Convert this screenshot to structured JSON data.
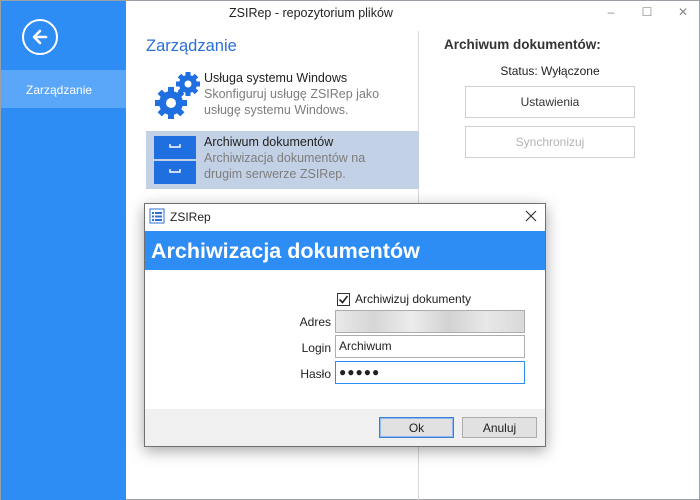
{
  "window": {
    "title": "ZSIRep - repozytorium plików",
    "minimize": "–",
    "maximize": "☐",
    "close": "✕"
  },
  "sidebar": {
    "back_icon": "arrow-left-circle-icon",
    "items": [
      {
        "label": "Zarządzanie"
      }
    ]
  },
  "main": {
    "section_title": "Zarządzanie",
    "items": [
      {
        "title": "Usługa systemu Windows",
        "description": "Skonfiguruj usługę ZSIRep jako usługę systemu Windows.",
        "icon": "gears-icon"
      },
      {
        "title": "Archiwum dokumentów",
        "description": "Archiwizacja dokumentów na drugim serwerze ZSIRep.",
        "icon": "archive-drawer-icon"
      }
    ]
  },
  "right_panel": {
    "title": "Archiwum dokumentów:",
    "status": "Status: Wyłączone",
    "settings_button": "Ustawienia",
    "sync_button": "Synchronizuj"
  },
  "dialog": {
    "title": "ZSIRep",
    "heading": "Archiwizacja dokumentów",
    "checkbox_label": "Archiwizuj dokumenty",
    "checkbox_checked": true,
    "fields": {
      "address_label": "Adres",
      "address_value": "",
      "login_label": "Login",
      "login_value": "Archiwum",
      "password_label": "Hasło",
      "password_value": "●●●●●"
    },
    "ok_button": "Ok",
    "cancel_button": "Anuluj"
  },
  "colors": {
    "accent": "#2e8cf5",
    "selected_item": "#c3d1e6",
    "section_title": "#2a6fd6"
  }
}
